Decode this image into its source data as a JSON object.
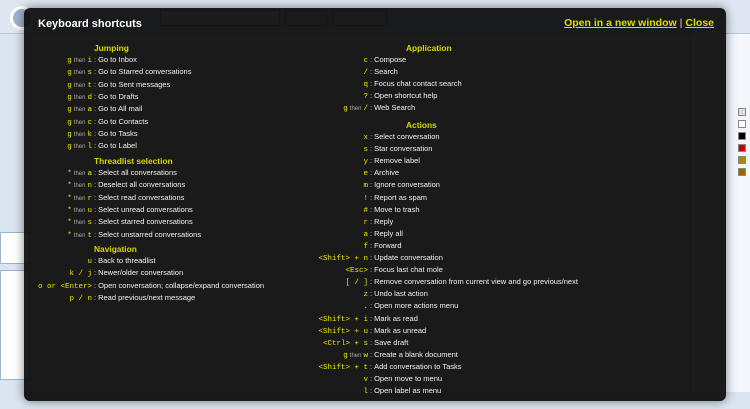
{
  "overlay": {
    "title": "Keyboard shortcuts",
    "open_window_link": "Open in a new window",
    "separator": "|",
    "close_link": "Close"
  },
  "left": {
    "jumping": {
      "title": "Jumping",
      "rows": [
        {
          "k1": "g",
          "k2": "i",
          "desc": "Go to Inbox"
        },
        {
          "k1": "g",
          "k2": "s",
          "desc": "Go to Starred conversations"
        },
        {
          "k1": "g",
          "k2": "t",
          "desc": "Go to Sent messages"
        },
        {
          "k1": "g",
          "k2": "d",
          "desc": "Go to Drafts"
        },
        {
          "k1": "g",
          "k2": "a",
          "desc": "Go to All mail"
        },
        {
          "k1": "g",
          "k2": "c",
          "desc": "Go to Contacts"
        },
        {
          "k1": "g",
          "k2": "k",
          "desc": "Go to Tasks"
        },
        {
          "k1": "g",
          "k2": "l",
          "desc": "Go to Label"
        }
      ]
    },
    "selection": {
      "title": "Threadlist selection",
      "rows": [
        {
          "k1": "*",
          "k2": "a",
          "desc": "Select all conversations"
        },
        {
          "k1": "*",
          "k2": "n",
          "desc": "Deselect all conversations"
        },
        {
          "k1": "*",
          "k2": "r",
          "desc": "Select read conversations"
        },
        {
          "k1": "*",
          "k2": "u",
          "desc": "Select unread conversations"
        },
        {
          "k1": "*",
          "k2": "s",
          "desc": "Select starred conversations"
        },
        {
          "k1": "*",
          "k2": "t",
          "desc": "Select unstarred conversations"
        }
      ]
    },
    "navigation": {
      "title": "Navigation",
      "rows": [
        {
          "keys": "u",
          "desc": "Back to threadlist"
        },
        {
          "keys": "k / j",
          "desc": "Newer/older conversation"
        },
        {
          "keys": "o or <Enter>",
          "desc": "Open conversation; collapse/expand conversation"
        },
        {
          "keys": "p / n",
          "desc": "Read previous/next message"
        }
      ]
    }
  },
  "right": {
    "application": {
      "title": "Application",
      "rows": [
        {
          "keys": "c",
          "desc": "Compose"
        },
        {
          "keys": "/",
          "desc": "Search"
        },
        {
          "keys": "q",
          "desc": "Focus chat contact search"
        },
        {
          "keys": "?",
          "desc": "Open shortcut help"
        },
        {
          "k1": "g",
          "k2": "/",
          "desc": "Web Search"
        }
      ]
    },
    "actions": {
      "title": "Actions",
      "rows": [
        {
          "keys": "x",
          "desc": "Select conversation"
        },
        {
          "keys": "s",
          "desc": "Star conversation"
        },
        {
          "keys": "y",
          "desc": "Remove label"
        },
        {
          "keys": "e",
          "desc": "Archive"
        },
        {
          "keys": "m",
          "desc": "Ignore conversation"
        },
        {
          "keys": "!",
          "desc": "Report as spam"
        },
        {
          "keys": "#",
          "desc": "Move to trash"
        },
        {
          "keys": "r",
          "desc": "Reply"
        },
        {
          "keys": "a",
          "desc": "Reply all"
        },
        {
          "keys": "f",
          "desc": "Forward"
        },
        {
          "keys": "<Shift> + n",
          "desc": "Update conversation"
        },
        {
          "keys": "<Esc>",
          "desc": "Focus last chat mole"
        },
        {
          "keys": "[ / ]",
          "desc": "Remove conversation from current view and go previous/next"
        },
        {
          "keys": "z",
          "desc": "Undo last action"
        },
        {
          "keys": ".",
          "desc": "Open more actions menu"
        },
        {
          "keys": "<Shift> + i",
          "desc": "Mark as read"
        },
        {
          "keys": "<Shift> + u",
          "desc": "Mark as unread"
        },
        {
          "keys": "<Ctrl> + s",
          "desc": "Save draft"
        },
        {
          "k1": "g",
          "k2": "w",
          "desc": "Create a blank document"
        },
        {
          "keys": "<Shift> + t",
          "desc": "Add conversation to Tasks"
        },
        {
          "keys": "v",
          "desc": "Open move to menu"
        },
        {
          "keys": "l",
          "desc": "Open label as menu"
        }
      ]
    }
  },
  "then_word": "then",
  "colors": {
    "overlay_bg": "#0a0a0a",
    "accent_yellow": "#d6d600",
    "text": "#f2f2f2"
  }
}
